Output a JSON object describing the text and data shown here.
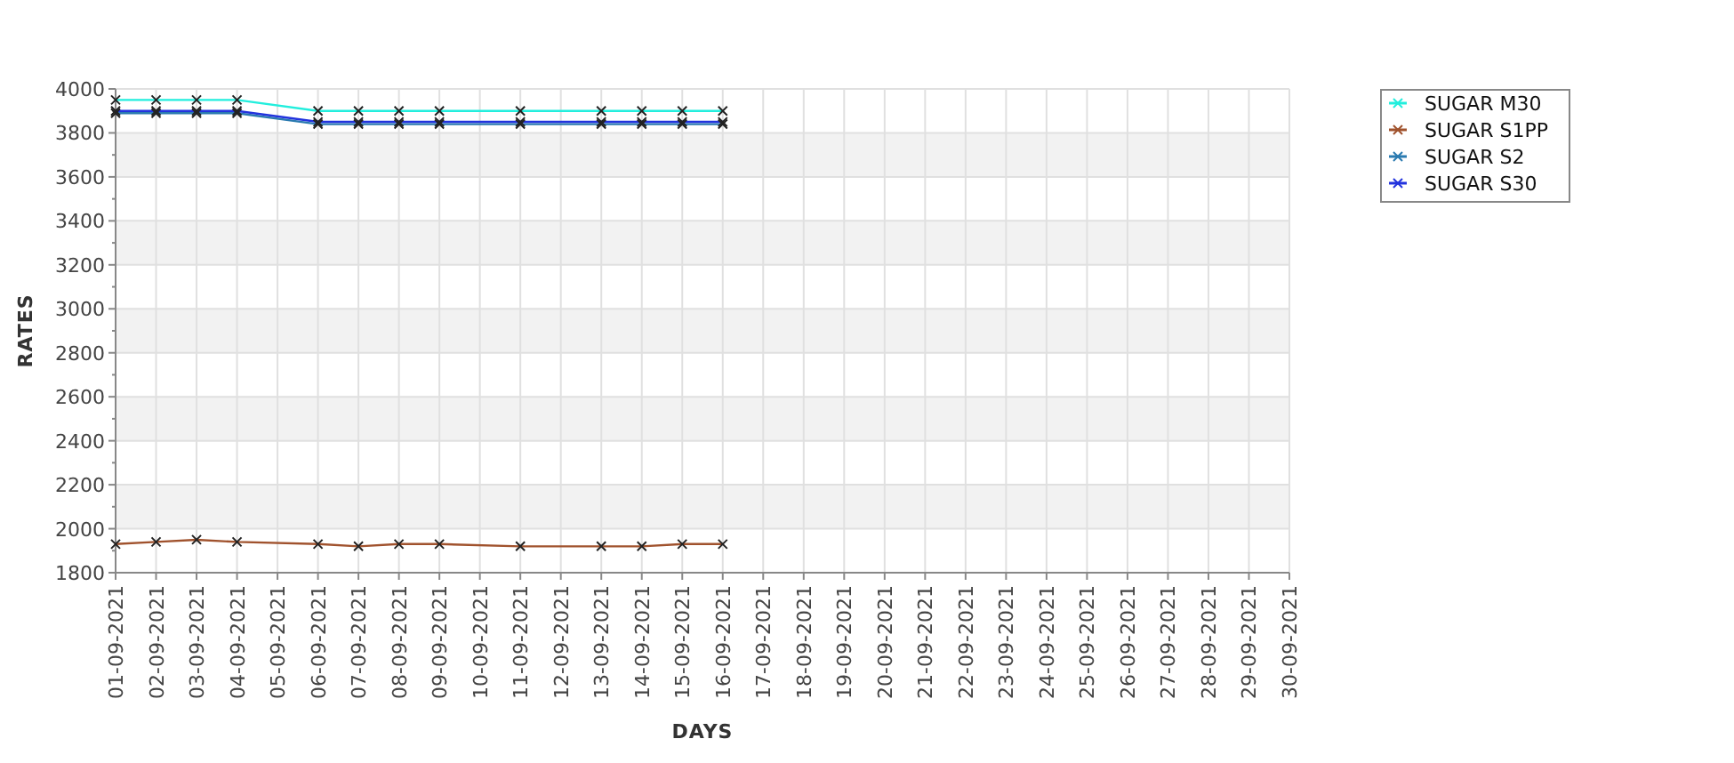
{
  "chart": {
    "chart_data": {
      "type": "line",
      "xlabel": "DAYS",
      "ylabel": "RATES",
      "grid": true,
      "legend": true,
      "categories": [
        "01-09-2021",
        "02-09-2021",
        "03-09-2021",
        "04-09-2021",
        "05-09-2021",
        "06-09-2021",
        "07-09-2021",
        "08-09-2021",
        "09-09-2021",
        "10-09-2021",
        "11-09-2021",
        "12-09-2021",
        "13-09-2021",
        "14-09-2021",
        "15-09-2021",
        "16-09-2021",
        "17-09-2021",
        "18-09-2021",
        "19-09-2021",
        "20-09-2021",
        "21-09-2021",
        "22-09-2021",
        "23-09-2021",
        "24-09-2021",
        "25-09-2021",
        "26-09-2021",
        "27-09-2021",
        "28-09-2021",
        "29-09-2021",
        "30-09-2021"
      ],
      "ylim": [
        1800,
        4000
      ],
      "yticks": [
        1800,
        2000,
        2200,
        2400,
        2600,
        2800,
        3000,
        3200,
        3400,
        3600,
        3800,
        4000
      ],
      "series": [
        {
          "name": "SUGAR M30",
          "color": "#22eedd",
          "marker": "cross",
          "values": [
            3950,
            3950,
            3950,
            3950,
            null,
            3900,
            3900,
            3900,
            3900,
            null,
            3900,
            null,
            3900,
            3900,
            3900,
            3900,
            null,
            null,
            null,
            null,
            null,
            null,
            null,
            null,
            null,
            null,
            null,
            null,
            null,
            null
          ]
        },
        {
          "name": "SUGAR S1PP",
          "color": "#a0522d",
          "marker": "cross",
          "values": [
            1930,
            1940,
            1950,
            1940,
            null,
            1930,
            1920,
            1930,
            1930,
            null,
            1920,
            null,
            1920,
            1920,
            1930,
            1930,
            null,
            null,
            null,
            null,
            null,
            null,
            null,
            null,
            null,
            null,
            null,
            null,
            null,
            null
          ]
        },
        {
          "name": "SUGAR S2",
          "color": "#2a7ab0",
          "marker": "cross",
          "values": [
            3890,
            3890,
            3890,
            3890,
            null,
            3840,
            3840,
            3840,
            3840,
            null,
            3840,
            null,
            3840,
            3840,
            3840,
            3840,
            null,
            null,
            null,
            null,
            null,
            null,
            null,
            null,
            null,
            null,
            null,
            null,
            null,
            null
          ]
        },
        {
          "name": "SUGAR S30",
          "color": "#2233dd",
          "marker": "cross",
          "values": [
            3900,
            3900,
            3900,
            3900,
            null,
            3850,
            3850,
            3850,
            3850,
            null,
            3850,
            null,
            3850,
            3850,
            3850,
            3850,
            null,
            null,
            null,
            null,
            null,
            null,
            null,
            null,
            null,
            null,
            null,
            null,
            null,
            null
          ]
        }
      ]
    }
  }
}
